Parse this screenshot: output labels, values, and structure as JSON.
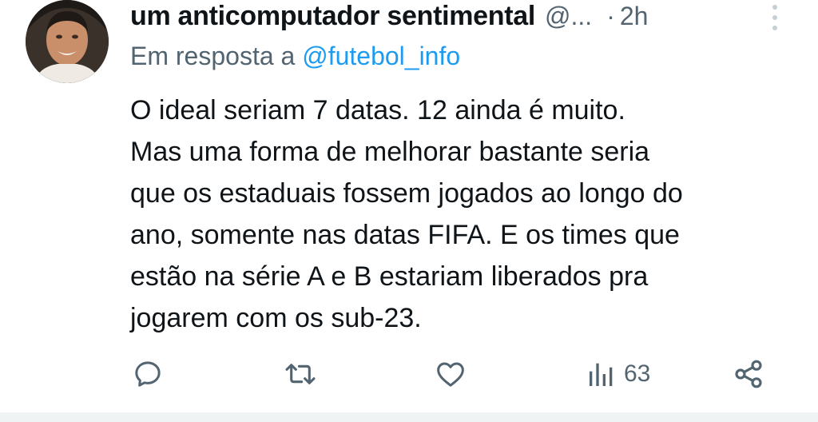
{
  "tweet": {
    "author": {
      "name": "um anticomputador sentimental",
      "handle": "@...",
      "avatar_icon": "user-avatar"
    },
    "separator": "·",
    "time": "2h",
    "reply_prefix": "Em resposta a",
    "reply_to": "@futebol_info",
    "text_lines": [
      "O ideal seriam 7 datas. 12 ainda é muito.",
      "Mas uma forma de melhorar bastante seria",
      "que os estaduais fossem jogados ao longo do",
      "ano, somente nas datas FIFA. E os times que",
      "estão na série A e B estariam liberados pra",
      "jogarem com os sub-23."
    ],
    "actions": {
      "reply_icon": "speech-bubble-icon",
      "retweet_icon": "retweet-icon",
      "like_icon": "heart-icon",
      "views_icon": "bar-chart-icon",
      "views_count": "63",
      "share_icon": "share-icon"
    }
  },
  "colors": {
    "text": "#0f1419",
    "secondary": "#536471",
    "link": "#1d9bf0",
    "divider": "#eff3f4"
  }
}
